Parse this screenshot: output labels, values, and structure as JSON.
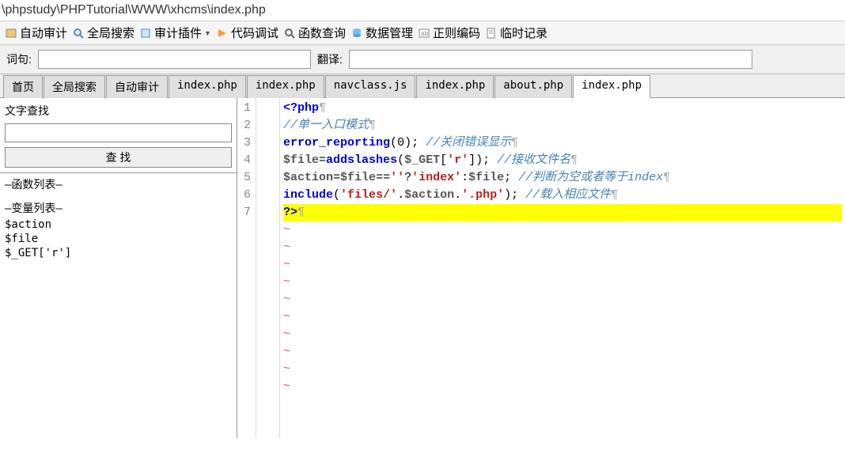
{
  "path": "\\phpstudy\\PHPTutorial\\WWW\\xhcms\\index.php",
  "toolbar": {
    "auto_audit": "自动审计",
    "global_search": "全局搜索",
    "audit_plugin": "审计插件",
    "code_debug": "代码调试",
    "func_query": "函数查询",
    "data_mgmt": "数据管理",
    "regex_encode": "正则编码",
    "temp_log": "临时记录"
  },
  "searchbar": {
    "word_label": "词句:",
    "word_value": "",
    "translate_label": "翻译:",
    "translate_value": ""
  },
  "tabs": [
    {
      "label": "首页"
    },
    {
      "label": "全局搜索"
    },
    {
      "label": "自动审计"
    },
    {
      "label": "index.php"
    },
    {
      "label": "index.php"
    },
    {
      "label": "navclass.js"
    },
    {
      "label": "index.php"
    },
    {
      "label": "about.php"
    },
    {
      "label": "index.php",
      "active": true
    }
  ],
  "find": {
    "title": "文字查找",
    "input_value": "",
    "btn_label": "查 找"
  },
  "func_list": {
    "header": "—函数列表—"
  },
  "var_list": {
    "header": "—变量列表—",
    "items": [
      "$action",
      "$file",
      "$_GET['r']"
    ]
  },
  "code": {
    "lines": [
      {
        "n": 1,
        "html": "<span class='kw'>&lt;?php</span><span class='pil'>¶</span>"
      },
      {
        "n": 2,
        "html": "<span class='cmt'>//单一入口模式</span><span class='pil'>¶</span>"
      },
      {
        "n": 3,
        "html": "<span class='fn'>error_reporting</span>(<span class='num'>0</span>); <span class='cmt'>//关闭错误显示</span><span class='pil'>¶</span>"
      },
      {
        "n": 4,
        "html": "<span class='var'>$file</span>=<span class='fn'>addslashes</span>(<span class='var'>$_GET</span>[<span class='str'>'r'</span>]); <span class='cmt'>//接收文件名</span><span class='pil'>¶</span>"
      },
      {
        "n": 5,
        "html": "<span class='var'>$action</span>=<span class='var'>$file</span>==<span class='str'>''</span>?<span class='str'>'index'</span>:<span class='var'>$file</span>; <span class='cmt'>//判断为空或者等于index</span><span class='pil'>¶</span>"
      },
      {
        "n": 6,
        "html": "<span class='fn'>include</span>(<span class='str'>'files/'</span>.<span class='var'>$action</span>.<span class='str'>'.php'</span>); <span class='cmt'>//载入相应文件</span><span class='pil'>¶</span>"
      },
      {
        "n": 7,
        "html": "<span class='kw'>?&gt;</span><span class='pil'>¶</span>",
        "highlight": true
      }
    ],
    "empty_rows": 10
  }
}
